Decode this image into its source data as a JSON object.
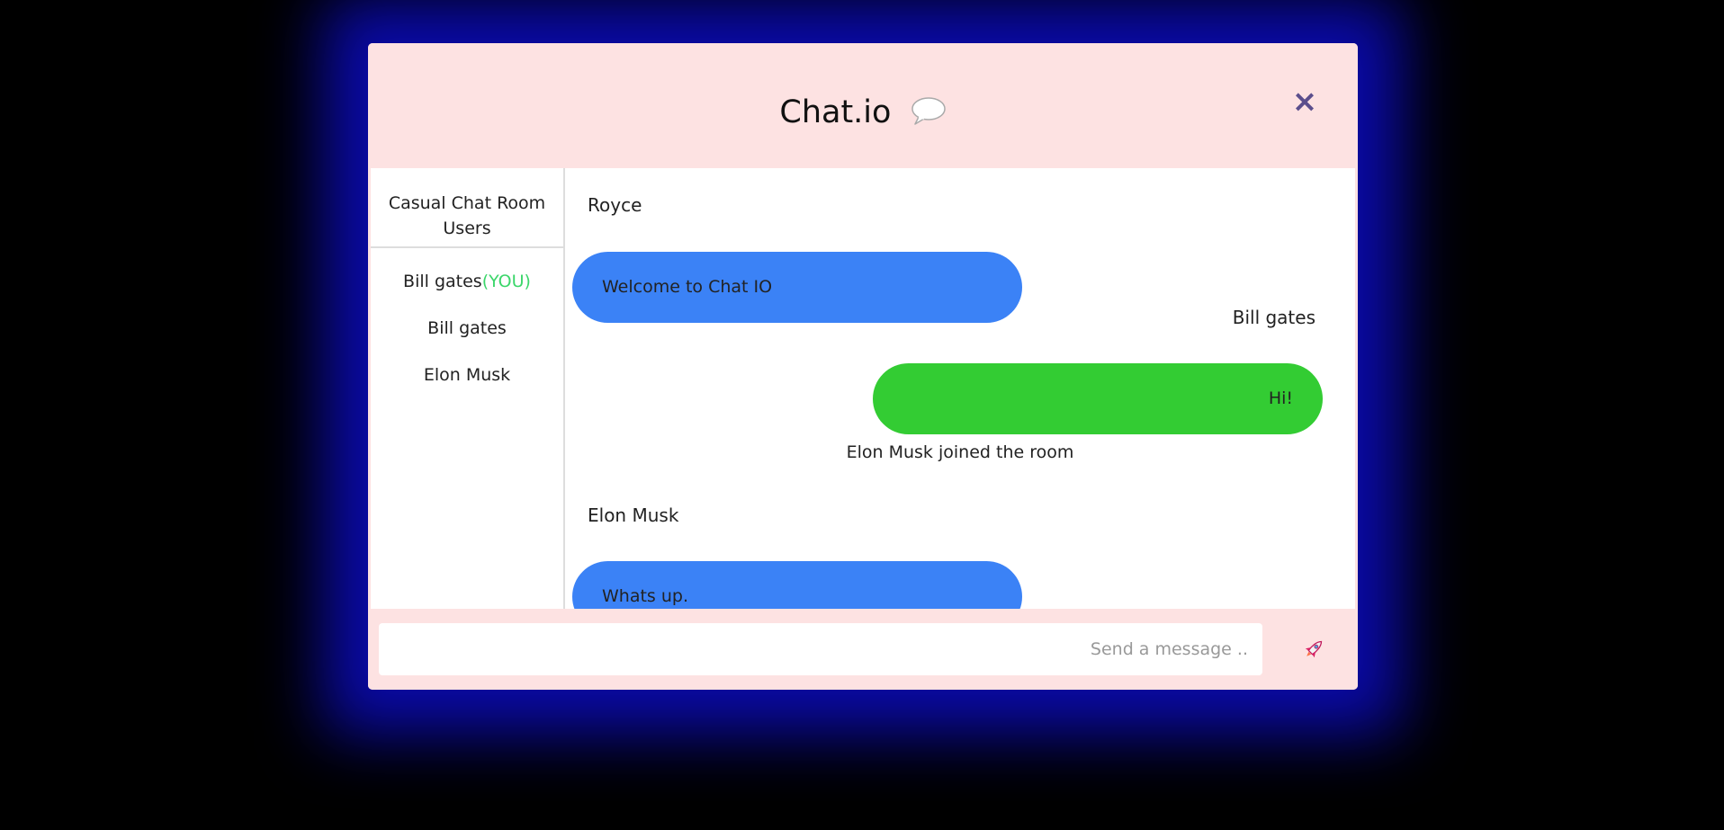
{
  "header": {
    "title": "Chat.io",
    "close_label": "×"
  },
  "sidebar": {
    "title": "Casual Chat Room Users",
    "users": [
      {
        "name": "Bill gates",
        "tag": "(YOU)"
      },
      {
        "name": "Bill gates",
        "tag": ""
      },
      {
        "name": "Elon Musk",
        "tag": ""
      }
    ]
  },
  "messages": [
    {
      "type": "incoming",
      "sender": "Royce",
      "text": "Welcome to Chat IO"
    },
    {
      "type": "outgoing",
      "sender": "Bill gates",
      "text": "Hi!"
    },
    {
      "type": "system",
      "text": "Elon Musk joined the room"
    },
    {
      "type": "incoming",
      "sender": "Elon Musk",
      "text": "Whats up."
    }
  ],
  "composer": {
    "placeholder": "Send a message ..",
    "value": ""
  },
  "colors": {
    "background": "#000000",
    "glow": "#0a0aa6",
    "panel": "#fde2e2",
    "incoming_bubble": "#3b82f6",
    "outgoing_bubble": "#33cc33",
    "you_tag": "#3bd66a",
    "close_icon": "#5b4e8c"
  },
  "icons": {
    "title_icon": "speech-bubble-icon",
    "close_icon": "close-icon",
    "send_icon": "rocket-icon"
  }
}
